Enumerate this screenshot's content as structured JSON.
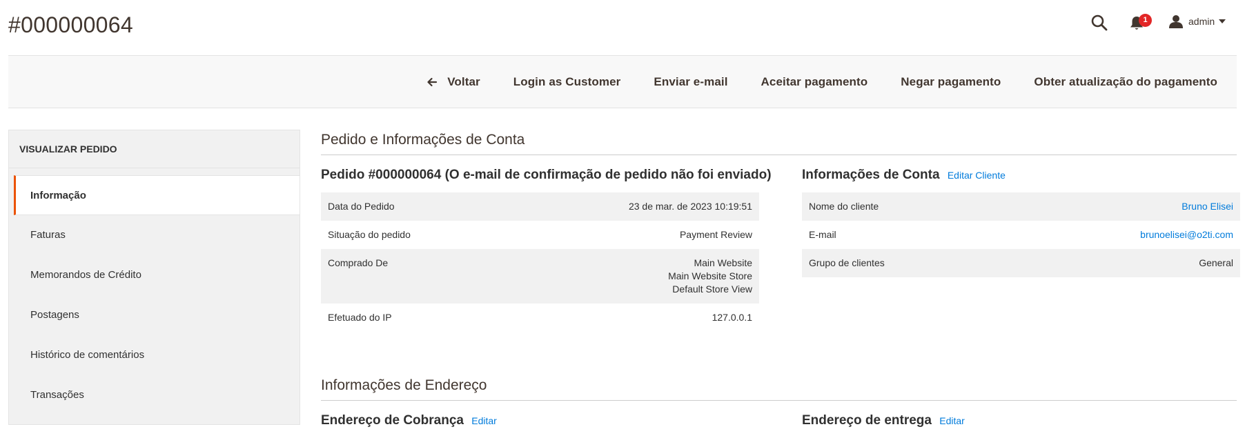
{
  "header": {
    "title": "#000000064",
    "notifications_count": "1",
    "user_name": "admin"
  },
  "action_bar": {
    "back_label": "Voltar",
    "login_as_customer_label": "Login as Customer",
    "send_email_label": "Enviar e-mail",
    "accept_payment_label": "Aceitar pagamento",
    "deny_payment_label": "Negar pagamento",
    "get_payment_update_label": "Obter atualização do pagamento"
  },
  "sidebar": {
    "title": "VISUALIZAR PEDIDO",
    "items": [
      {
        "label": "Informação",
        "active": true
      },
      {
        "label": "Faturas",
        "active": false
      },
      {
        "label": "Memorandos de Crédito",
        "active": false
      },
      {
        "label": "Postagens",
        "active": false
      },
      {
        "label": "Histórico de comentários",
        "active": false
      },
      {
        "label": "Transações",
        "active": false
      }
    ]
  },
  "order_section": {
    "title": "Pedido e Informações de Conta",
    "order": {
      "title": "Pedido #000000064 (O e-mail de confirmação de pedido não foi enviado)",
      "rows": {
        "date_label": "Data do Pedido",
        "date_value": "23 de mar. de 2023 10:19:51",
        "status_label": "Situação do pedido",
        "status_value": "Payment Review",
        "purchased_from_label": "Comprado De",
        "purchased_from_lines": [
          "Main Website",
          "Main Website Store",
          "Default Store View"
        ],
        "ip_label": "Efetuado do IP",
        "ip_value": "127.0.0.1"
      }
    },
    "account": {
      "title": "Informações de Conta",
      "edit_label": "Editar Cliente",
      "rows": {
        "name_label": "Nome do cliente",
        "name_value": "Bruno Elisei",
        "email_label": "E-mail",
        "email_value": "brunoelisei@o2ti.com",
        "group_label": "Grupo de clientes",
        "group_value": "General"
      }
    }
  },
  "address_section": {
    "title": "Informações de Endereço",
    "billing_title": "Endereço de Cobrança",
    "billing_edit_label": "Editar",
    "shipping_title": "Endereço de entrega",
    "shipping_edit_label": "Editar"
  },
  "colors": {
    "accent": "#eb5202",
    "link": "#007bdb",
    "badge": "#e22626"
  },
  "icons": {
    "search": "search-icon",
    "notifications": "bell-icon",
    "user": "user-icon",
    "dropdown": "caret-down-icon",
    "back": "arrow-left-icon"
  }
}
